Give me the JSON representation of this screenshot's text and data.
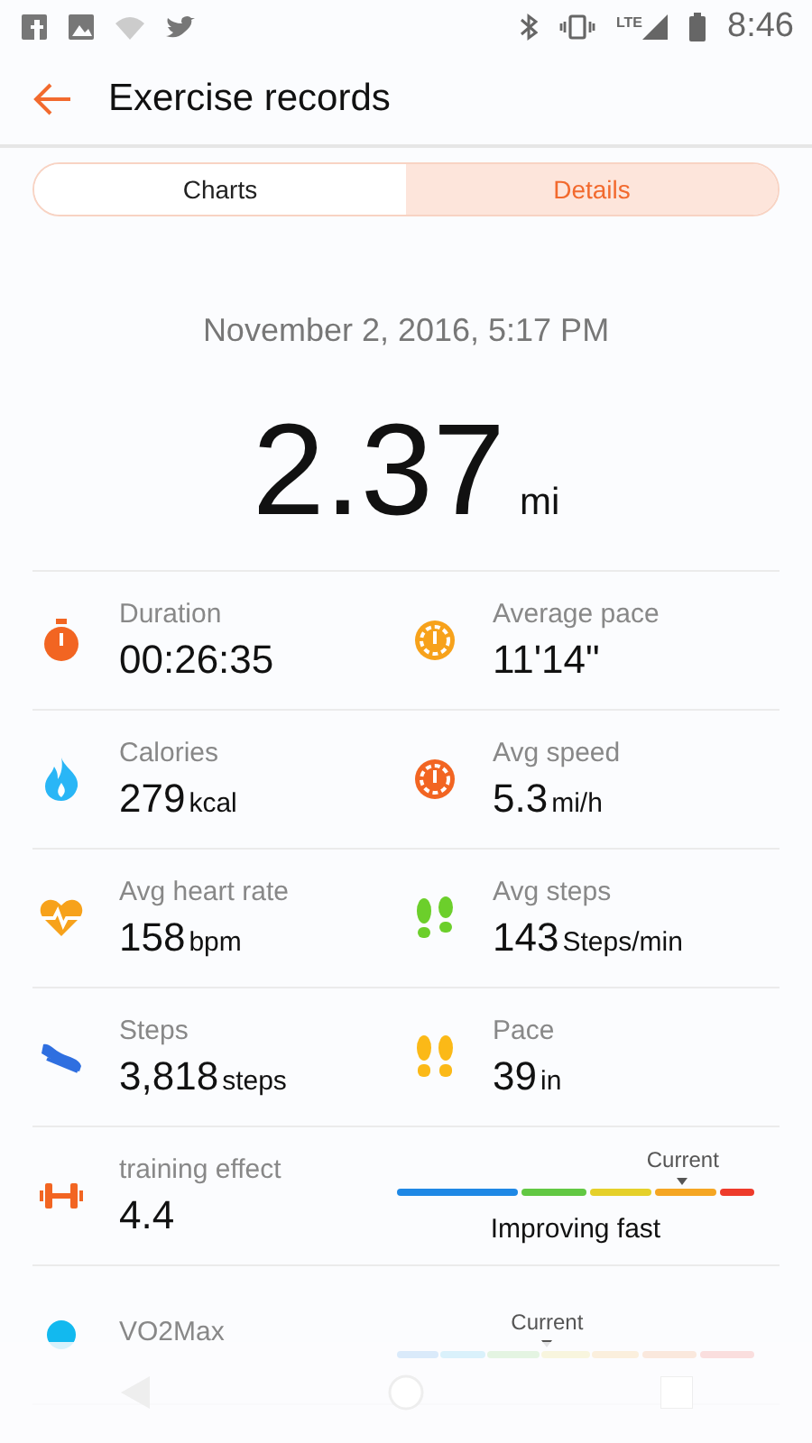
{
  "status_bar": {
    "network": "LTE",
    "time": "8:46"
  },
  "app_bar": {
    "title": "Exercise records"
  },
  "tabs": [
    {
      "label": "Charts",
      "selected": false
    },
    {
      "label": "Details",
      "selected": true
    }
  ],
  "date": "November 2, 2016, 5:17 PM",
  "distance": {
    "value": "2.37",
    "unit": "mi"
  },
  "rows": [
    {
      "kind": "pair",
      "items": [
        {
          "label": "Duration",
          "value": "00:26:35"
        },
        {
          "label": "Average pace",
          "value": "11'14\""
        }
      ]
    },
    {
      "kind": "pair",
      "items": [
        {
          "label": "Calories",
          "value": "279",
          "unit": "kcal"
        },
        {
          "label": "Avg speed",
          "value": "5.3",
          "unit": "mi/h"
        }
      ]
    },
    {
      "kind": "pair",
      "items": [
        {
          "label": "Avg heart rate",
          "value": "158",
          "unit": "bpm"
        },
        {
          "label": "Avg steps",
          "value": "143",
          "unit": "Steps/min"
        }
      ]
    },
    {
      "kind": "pair",
      "items": [
        {
          "label": "Steps",
          "value": "3,818",
          "unit": "steps"
        },
        {
          "label": "Pace",
          "value": "39",
          "unit": "in"
        }
      ]
    },
    {
      "kind": "gauge",
      "label": "training effect",
      "value": "4.4",
      "marker": "Current",
      "caption": "Improving fast"
    },
    {
      "kind": "gauge",
      "label": "VO2Max",
      "marker": "Current"
    }
  ]
}
